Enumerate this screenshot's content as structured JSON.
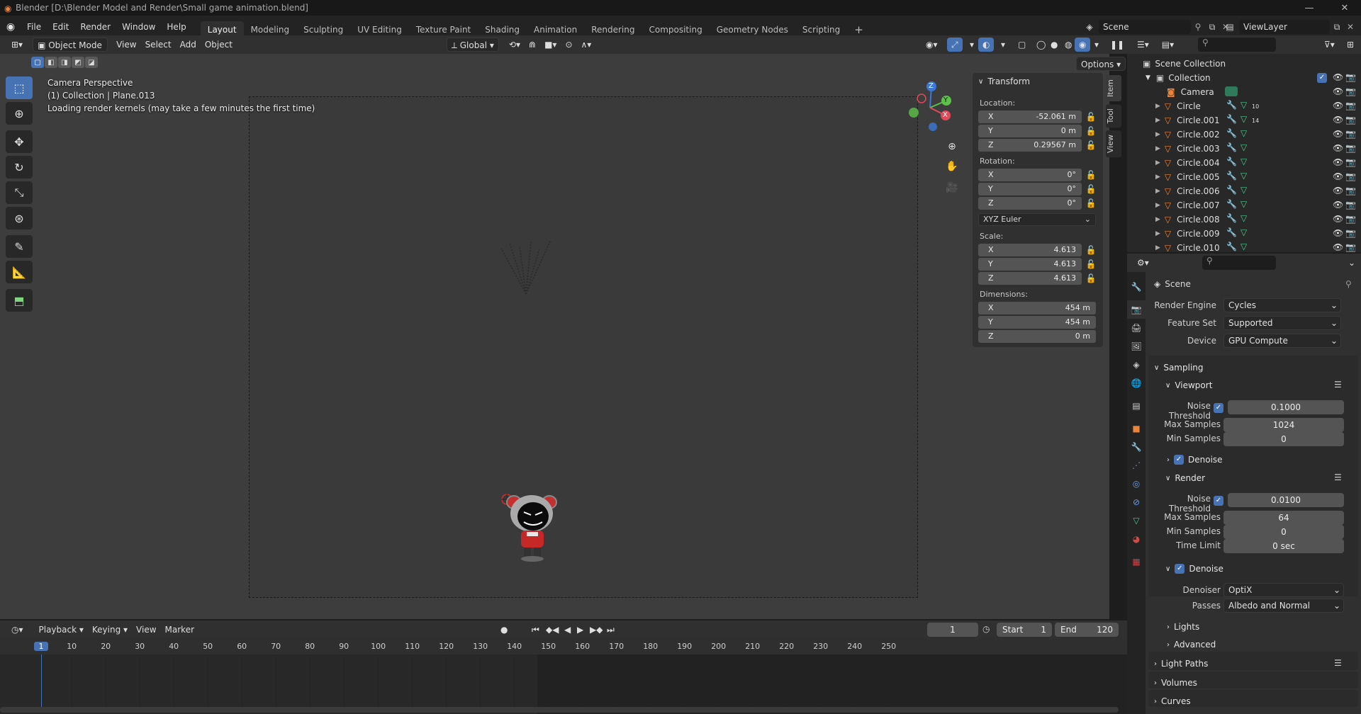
{
  "window": {
    "title": "Blender [D:\\Blender Model and Render\\Small game animation.blend]",
    "minimize": "—",
    "maximize": "❐",
    "close": "✕"
  },
  "menu": [
    "File",
    "Edit",
    "Render",
    "Window",
    "Help"
  ],
  "workspaces": [
    {
      "label": "Layout",
      "active": true
    },
    {
      "label": "Modeling"
    },
    {
      "label": "Sculpting"
    },
    {
      "label": "UV Editing"
    },
    {
      "label": "Texture Paint"
    },
    {
      "label": "Shading"
    },
    {
      "label": "Animation"
    },
    {
      "label": "Rendering"
    },
    {
      "label": "Compositing"
    },
    {
      "label": "Geometry Nodes"
    },
    {
      "label": "Scripting"
    }
  ],
  "add_workspace": "+",
  "scene": {
    "name": "Scene",
    "view_layer": "ViewLayer"
  },
  "viewport_header": {
    "mode": "Object Mode",
    "menus": [
      "View",
      "Select",
      "Add",
      "Object"
    ],
    "orientation": "Global",
    "options": "Options"
  },
  "viewport_overlay": {
    "line1": "Camera Perspective",
    "line2": "(1) Collection | Plane.013",
    "line3": "Loading render kernels (may take a few minutes the first time)"
  },
  "gizmo": {
    "x": "X",
    "y": "Y",
    "z": "Z"
  },
  "npanel": {
    "section": "Transform",
    "location_label": "Location:",
    "location": [
      {
        "axis": "X",
        "value": "-52.061 m"
      },
      {
        "axis": "Y",
        "value": "0 m"
      },
      {
        "axis": "Z",
        "value": "0.29567 m"
      }
    ],
    "rotation_label": "Rotation:",
    "rotation": [
      {
        "axis": "X",
        "value": "0°"
      },
      {
        "axis": "Y",
        "value": "0°"
      },
      {
        "axis": "Z",
        "value": "0°"
      }
    ],
    "rotation_mode": "XYZ Euler",
    "scale_label": "Scale:",
    "scale": [
      {
        "axis": "X",
        "value": "4.613"
      },
      {
        "axis": "Y",
        "value": "4.613"
      },
      {
        "axis": "Z",
        "value": "4.613"
      }
    ],
    "dimensions_label": "Dimensions:",
    "dimensions": [
      {
        "axis": "X",
        "value": "454 m"
      },
      {
        "axis": "Y",
        "value": "454 m"
      },
      {
        "axis": "Z",
        "value": "0 m"
      }
    ],
    "tabs": [
      "Item",
      "Tool",
      "View"
    ]
  },
  "timeline": {
    "menus": [
      "Playback",
      "Keying",
      "View",
      "Marker"
    ],
    "current_frame": "1",
    "start_label": "Start",
    "start": "1",
    "end_label": "End",
    "end": "120",
    "ticks": [
      "1",
      "10",
      "20",
      "30",
      "40",
      "50",
      "60",
      "70",
      "80",
      "90",
      "100",
      "110",
      "120",
      "130",
      "140",
      "150",
      "160",
      "170",
      "180",
      "190",
      "200",
      "210",
      "220",
      "230",
      "240",
      "250"
    ]
  },
  "outliner": {
    "root": "Scene Collection",
    "collection": "Collection",
    "items": [
      {
        "name": "Camera",
        "type": "camera"
      },
      {
        "name": "Circle",
        "badge": "10"
      },
      {
        "name": "Circle.001",
        "badge": "14"
      },
      {
        "name": "Circle.002"
      },
      {
        "name": "Circle.003"
      },
      {
        "name": "Circle.004"
      },
      {
        "name": "Circle.005"
      },
      {
        "name": "Circle.006"
      },
      {
        "name": "Circle.007"
      },
      {
        "name": "Circle.008"
      },
      {
        "name": "Circle.009"
      },
      {
        "name": "Circle.010"
      }
    ]
  },
  "properties": {
    "context": "Scene",
    "render_engine_label": "Render Engine",
    "render_engine": "Cycles",
    "feature_set_label": "Feature Set",
    "feature_set": "Supported",
    "device_label": "Device",
    "device": "GPU Compute",
    "sampling": "Sampling",
    "viewport": "Viewport",
    "vp_noise_threshold_label": "Noise Threshold",
    "vp_noise_threshold": "0.1000",
    "vp_max_samples_label": "Max Samples",
    "vp_max_samples": "1024",
    "vp_min_samples_label": "Min Samples",
    "vp_min_samples": "0",
    "vp_denoise": "Denoise",
    "render": "Render",
    "r_noise_threshold_label": "Noise Threshold",
    "r_noise_threshold": "0.0100",
    "r_max_samples_label": "Max Samples",
    "r_max_samples": "64",
    "r_min_samples_label": "Min Samples",
    "r_min_samples": "0",
    "r_time_limit_label": "Time Limit",
    "r_time_limit": "0 sec",
    "r_denoise": "Denoise",
    "denoiser_label": "Denoiser",
    "denoiser": "OptiX",
    "passes_label": "Passes",
    "passes": "Albedo and Normal",
    "lights": "Lights",
    "advanced": "Advanced",
    "light_paths": "Light Paths",
    "volumes": "Volumes",
    "curves": "Curves"
  },
  "colors": {
    "accent": "#4772b3",
    "orange": "#e8853a",
    "green": "#4ec98b",
    "red_x": "#e24a5a"
  }
}
